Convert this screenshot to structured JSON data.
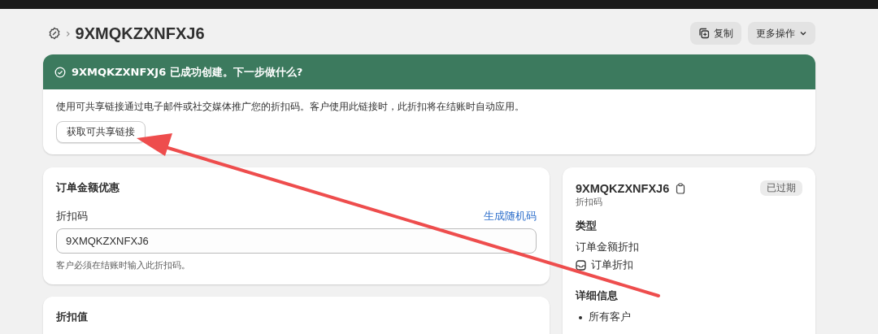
{
  "header": {
    "breadcrumb_separator": "›",
    "title": "9XMQKZXNFXJ6",
    "actions": [
      {
        "kind": "duplicate",
        "label": "复制"
      },
      {
        "kind": "menu",
        "label": "更多操作"
      }
    ]
  },
  "banner": {
    "title": "9XMQKZXNFXJ6 已成功创建。下一步做什么?",
    "message": "使用可共享链接通过电子邮件或社交媒体推广您的折扣码。客户使用此链接时，此折扣将在结账时自动应用。",
    "button": "获取可共享链接"
  },
  "discount_card": {
    "title": "订单金额优惠",
    "field_label": "折扣码",
    "generate_link": "生成随机码",
    "value": "9XMQKZXNFXJ6",
    "help": "客户必须在结账时输入此折扣码。"
  },
  "value_card": {
    "title": "折扣值"
  },
  "summary": {
    "code": "9XMQKZXNFXJ6",
    "subtitle": "折扣码",
    "status": "已过期",
    "type_heading": "类型",
    "type": "订单金额折扣",
    "type_item": "订单折扣",
    "details_heading": "详细信息",
    "details": [
      "所有客户"
    ]
  }
}
